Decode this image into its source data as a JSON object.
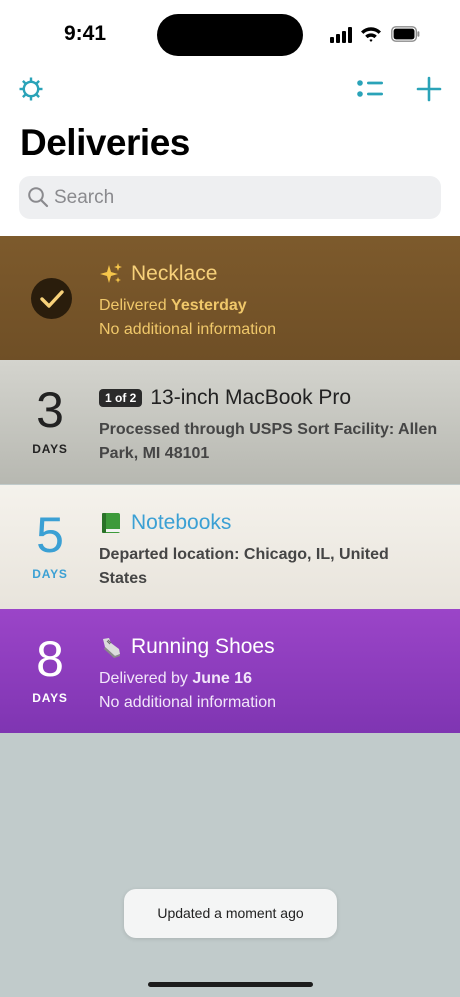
{
  "status_bar": {
    "time": "9:41"
  },
  "header": {
    "title": "Deliveries"
  },
  "search": {
    "placeholder": "Search"
  },
  "colors": {
    "accent": "#2aa3b8",
    "delivered_row": "#7d5a2c",
    "purple_row": "#8a3dbd"
  },
  "deliveries": [
    {
      "icon": "sparkles",
      "name": "Necklace",
      "status_prefix": "Delivered",
      "status_emphasis": "Yesterday",
      "info": "No additional information",
      "delivered": true
    },
    {
      "days": "3",
      "days_label": "DAYS",
      "badge": "1 of 2",
      "name": "13-inch MacBook Pro",
      "status": "Processed through USPS Sort Facility: Allen Park, MI 48101"
    },
    {
      "days": "5",
      "days_label": "DAYS",
      "icon": "green-book",
      "name": "Notebooks",
      "status": "Departed location: Chicago, IL, United States"
    },
    {
      "days": "8",
      "days_label": "DAYS",
      "icon": "running-shoe",
      "name": "Running Shoes",
      "status_prefix": "Delivered by",
      "status_emphasis": "June 16",
      "info": "No additional information"
    }
  ],
  "toast": {
    "text": "Updated a moment ago"
  }
}
